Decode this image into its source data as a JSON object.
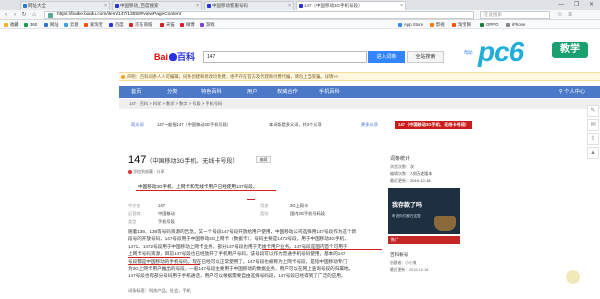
{
  "browser": {
    "tabs": [
      {
        "label": "网址大全",
        "color": "#2f77d1"
      },
      {
        "label": "中国移动_百度搜索",
        "color": "#2932e1"
      },
      {
        "label": "中国移动客服号码",
        "color": "#2932e1"
      },
      {
        "label": "147（中国移动3G手机号段）",
        "color": "#2932e1"
      }
    ],
    "url": "https://baike.baidu.com/item/147/13558#viewPageContent",
    "search_placeholder": "在此搜索",
    "window_controls": "— ❐ ✕",
    "bookmarks": [
      "收藏",
      "360",
      "网址",
      "云盘",
      "爱淘宝",
      "百度",
      "京东商城",
      "天猫",
      "微博",
      "游戏",
      "App Store",
      "影视",
      "淘宝网",
      "OPPO",
      "iPhone"
    ]
  },
  "baidu": {
    "logo_text": "Bai",
    "logo_du": "百科",
    "search_value": "147",
    "enter_label": "进入词条",
    "search_label": "全站搜索",
    "help_label": "帮助",
    "notice": "声明：百科词条人人可编辑，词条创建和修改均免费，绝不存在官方及代理商付费代编，请勿上当受骗。详情>>",
    "nav": [
      "首页",
      "分类",
      "特色百科",
      "用户",
      "权威合作",
      "手机百科",
      "个人中心"
    ],
    "subnav": "147 · 百科 > 科学 > 数学 > 数字 > 号段 > 手机号码",
    "crumbs": [
      "同义词",
      "147一般指147（中国移动3G手机号段）",
      "本词条是多义词，共3个义项",
      "更多义项",
      "147（中国移动3G手机、无线卡号段）"
    ]
  },
  "article": {
    "title": "147",
    "subtitle": "（中国移动3G手机、无线卡号段）",
    "edit_label": "编辑",
    "tools": "添加到收藏 · 分享",
    "summary": "中国移动3G手机、上网卡和无线卡用户已经使用147号段。",
    "basic_left": [
      {
        "k": "中文名",
        "v": "147"
      },
      {
        "k": "运营商",
        "v": "中国移动"
      },
      {
        "k": "类型",
        "v": "手机号段"
      }
    ],
    "basic_right": [
      {
        "k": "用途",
        "v": "3G上网卡"
      },
      {
        "k": "类别",
        "v": "国内3G手机号码段"
      }
    ],
    "paragraph": [
      "随着139、138等号码资源的告急，又一个号段147号段开放给用户使用，中国移动公司选择用147号段作为这个新",
      "段号的开放号码，147号段用于中国移动3G上网卡（数据卡），号码主要是1473号段，用于中国移动3G手机，",
      "1471、1472号段用于中国移动上网卡业务，部分147号段也用于无线卡用户业务。147号段是国内首个可用于",
      "上网卡号码资源，目前147号段也已经放开了手机用户号码，该号段可以作为普通手机号码使用，基本的147",
      "号段都是中国移动的手机号码，现在已经可以正常使用了。147号段也被称为上网卡号段，是指中国移动专门",
      "为3G上网卡用户推出的号段，一般147号段主要用于中国移动的数据业务，用户可以在网上查询号段的归属地。",
      "147号段也有部分号码用于手机通话，用户可以根据需要自由选择号码段，147号段已经得到了广泛的应用。"
    ],
    "footer": "词条标签：科技产品，社会，手机"
  },
  "sidebar": {
    "title": "词条统计",
    "stats": [
      {
        "k": "浏览次数：",
        "v": "次"
      },
      {
        "k": "编辑次数：",
        "v": "7次历史版本"
      },
      {
        "k": "最近更新：",
        "v": "2019-12-18"
      }
    ],
    "ad_title": "我的百科",
    "ad_line1": "我存款了吗",
    "ad_sub": "听说你们都在这里",
    "ad_bar": "推广",
    "rank_title": "百科帐号",
    "footer_lines": [
      "创建者：小小鬼",
      "最近更新：2019-12-18"
    ]
  },
  "watermark": {
    "brand": "pc6",
    "tag": "教学"
  }
}
